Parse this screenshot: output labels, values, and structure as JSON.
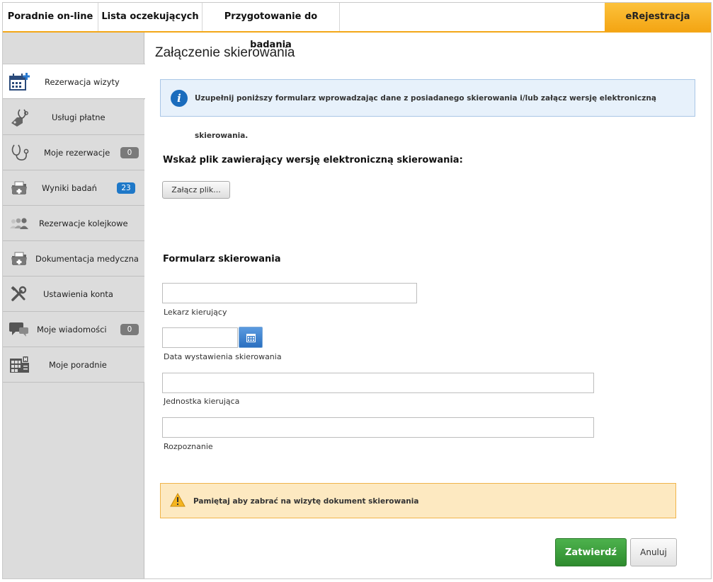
{
  "topnav": {
    "tabs": [
      {
        "label": "Poradnie on-line"
      },
      {
        "label": "Lista oczekujących"
      },
      {
        "label": "Przygotowanie do badania"
      }
    ],
    "active_tab": {
      "label": "eRejestracja"
    }
  },
  "sidebar": {
    "items": [
      {
        "label": "Rezerwacja wizyty",
        "icon": "calendar-plus-icon",
        "active": true
      },
      {
        "label": "Usługi płatne",
        "icon": "stethoscope-tag-icon"
      },
      {
        "label": "Moje rezerwacje",
        "icon": "stethoscope-icon",
        "badge": "0"
      },
      {
        "label": "Wyniki badań",
        "icon": "medical-folder-icon",
        "badge": "23"
      },
      {
        "label": "Rezerwacje kolejkowe",
        "icon": "people-queue-icon"
      },
      {
        "label": "Dokumentacja medyczna",
        "icon": "medical-folder-icon"
      },
      {
        "label": "Ustawienia konta",
        "icon": "tools-icon"
      },
      {
        "label": "Moje wiadomości",
        "icon": "chat-bubbles-icon",
        "badge": "0"
      },
      {
        "label": "Moje poradnie",
        "icon": "building-icon"
      }
    ]
  },
  "main": {
    "title": "Załączenie skierowania",
    "info": "Uzupełnij poniższy formularz wprowadzając dane z posiadanego skierowania i/lub załącz wersję elektroniczną skierowania.",
    "file_section": {
      "heading": "Wskaż plik zawierający wersję elektroniczną skierowania:",
      "attach_label": "Załącz plik..."
    },
    "form": {
      "heading": "Formularz skierowania",
      "fields": [
        {
          "label": "Lekarz kierujący",
          "value": ""
        },
        {
          "label": "Data wystawienia skierowania",
          "value": ""
        },
        {
          "label": "Jednostka kierująca",
          "value": ""
        },
        {
          "label": "Rozpoznanie",
          "value": ""
        }
      ]
    },
    "warning": "Pamiętaj aby zabrać na wizytę dokument skierowania",
    "submit_label": "Zatwierdź",
    "cancel_label": "Anuluj"
  },
  "colors": {
    "accent": "#f3a718",
    "info_icon": "#1a6cbd",
    "submit": "#3a9a3a",
    "badge_blue": "#1e78c8",
    "badge_gray": "#7a7a7a"
  }
}
